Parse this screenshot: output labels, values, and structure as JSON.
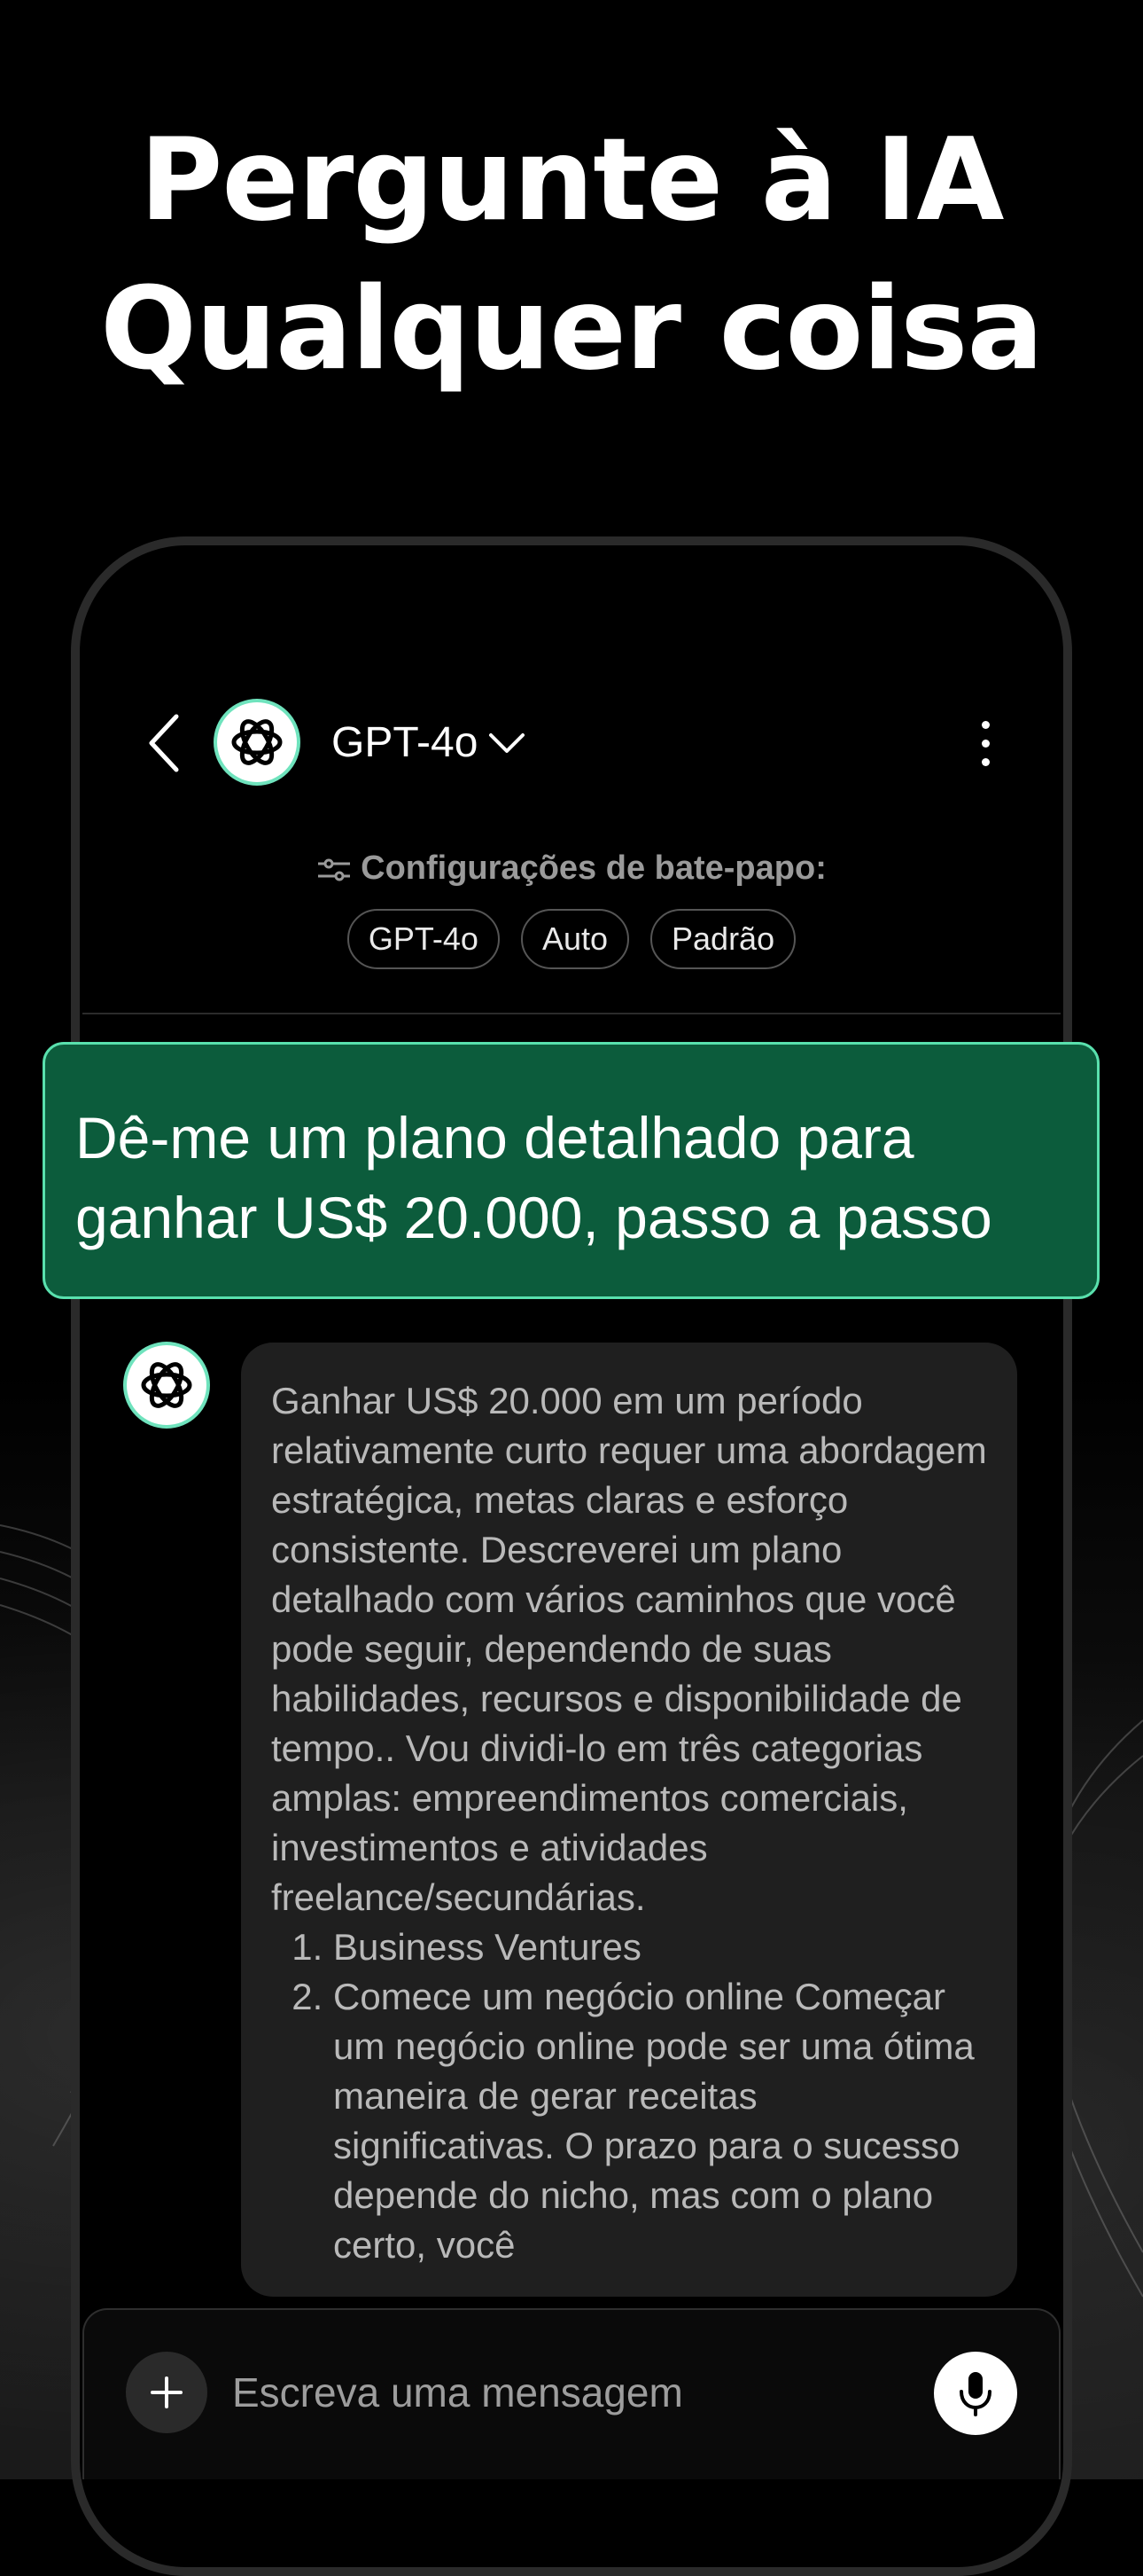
{
  "headline": {
    "line1": "Pergunte à IA",
    "line2": "Qualquer coisa"
  },
  "header": {
    "model_name": "GPT-4o",
    "icons": {
      "back": "chevron-left-icon",
      "dropdown": "chevron-down-icon",
      "more": "more-vertical-icon",
      "logo": "openai-logo-icon"
    }
  },
  "chat_settings": {
    "label": "Configurações de bate-papo:",
    "chips": [
      "GPT-4o",
      "Auto",
      "Padrão"
    ]
  },
  "user_message": "Dê-me um plano detalhado para ganhar US$ 20.000, passo a passo",
  "ai_message": {
    "paragraph": "Ganhar US$ 20.000 em um período relativamente curto requer uma abordagem estratégica, metas claras e esforço consistente. Descreverei um plano detalhado com vários caminhos que você pode seguir, dependendo de suas habilidades, recursos e disponibilidade de tempo.. Vou dividi-lo em três categorias amplas: empreendimentos comerciais, investimentos e atividades freelance/secundárias.",
    "list_item_1": "Business Ventures",
    "list_item_2": "Comece um negócio online Começar um negócio online pode ser uma ótima maneira de gerar receitas significativas. O prazo para o sucesso depende do nicho, mas com o plano certo, você"
  },
  "input": {
    "placeholder": "Escreva uma mensagem"
  },
  "colors": {
    "user_bubble": "#0c5c3c",
    "user_border": "#59e0ad",
    "ai_bubble": "#1f1f1f",
    "background": "#000000"
  }
}
